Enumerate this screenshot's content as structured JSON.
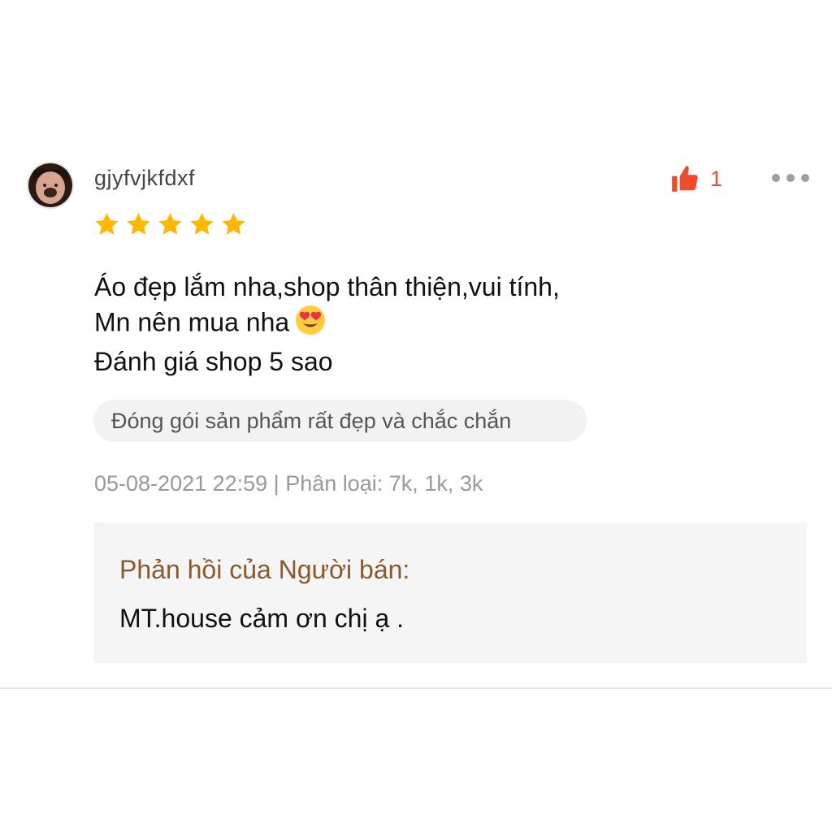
{
  "review": {
    "username": "gjyfvjkfdxf",
    "rating": 5,
    "like_count": "1",
    "comment_lines": [
      "Áo đẹp lắm nha,shop thân thiện,vui tính,",
      "Mn nên mua nha",
      "Đánh giá shop 5 sao"
    ],
    "comment_emoji": "smiling-face-with-heart-eyes",
    "tag": "Đóng gói sản phẩm rất đẹp và chắc chắn",
    "meta": "05-08-2021 22:59 | Phân loại: 7k, 1k, 3k"
  },
  "seller_reply": {
    "title": "Phản hồi của Người bán:",
    "text": "MT.house cảm ơn chị ạ ."
  },
  "icons": {
    "like": "thumbs-up-icon",
    "more": "more-dots-icon",
    "star": "star-icon"
  },
  "colors": {
    "accent": "#ee4d2d",
    "star": "#ffb700",
    "reply_title": "#8a5a2b"
  }
}
